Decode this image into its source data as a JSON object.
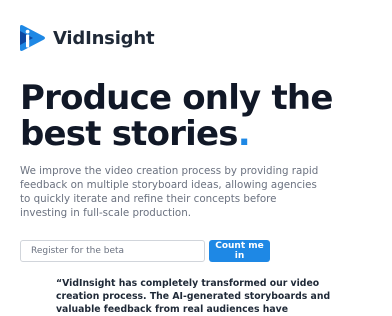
{
  "brand": {
    "name": "VidInsight",
    "logo_icon": "play-triangle-logo-icon"
  },
  "hero": {
    "headline_line1": "Produce only the",
    "headline_line2": "best stories",
    "headline_dot": ".",
    "description": "We improve the video creation process by providing rapid feedback on multiple storyboard ideas, allowing agencies to quickly iterate and refine their concepts before investing in full-scale production."
  },
  "signup": {
    "placeholder": "Register for the beta",
    "button_label": "Count me in"
  },
  "testimonial": {
    "quote": "“VidInsight has completely transformed our video creation process. The AI-generated storyboards and valuable feedback from real audiences have"
  },
  "colors": {
    "accent": "#1e88e5",
    "text_dark": "#111827",
    "text_muted": "#6b7280"
  }
}
